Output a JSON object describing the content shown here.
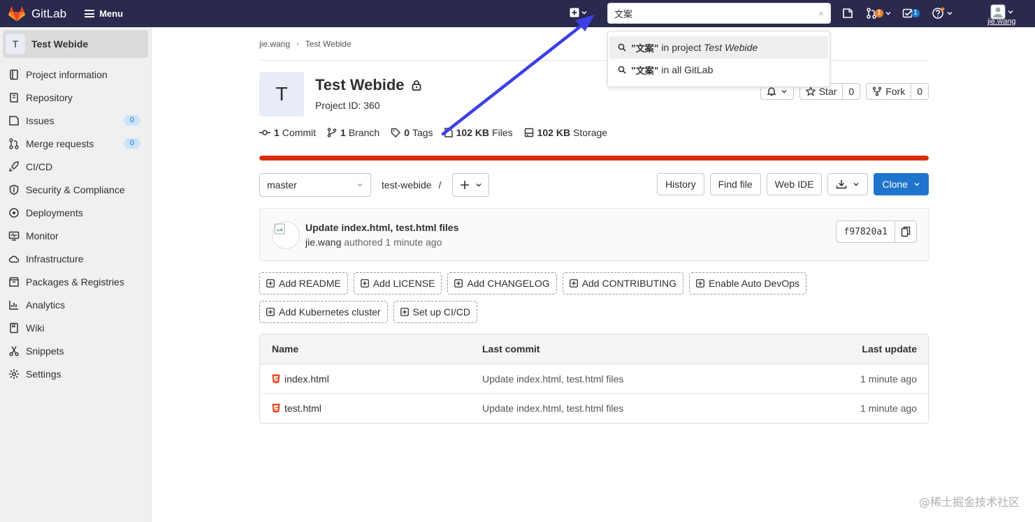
{
  "navbar": {
    "brand": "GitLab",
    "menu_label": "Menu",
    "search_value": "文案",
    "search_clear": "×",
    "merge_requests_count": "1",
    "todos_count": "1",
    "user_name": "jie.wang",
    "colors": {
      "navbar_bg": "#2a2a4f",
      "orange_badge": "#e9822a",
      "blue_badge": "#1f75cb"
    }
  },
  "search_dropdown": {
    "items": [
      {
        "query": "\"文案\"",
        "prefix": " in project ",
        "scope": "Test Webide"
      },
      {
        "query": "\"文案\"",
        "prefix": " in all GitLab",
        "scope": ""
      }
    ]
  },
  "sidebar": {
    "project_initial": "T",
    "project_name": "Test Webide",
    "items": [
      {
        "label": "Project information",
        "icon": "info-icon"
      },
      {
        "label": "Repository",
        "icon": "book-icon"
      },
      {
        "label": "Issues",
        "icon": "issues-icon",
        "count": "0"
      },
      {
        "label": "Merge requests",
        "icon": "merge-request-icon",
        "count": "0"
      },
      {
        "label": "CI/CD",
        "icon": "rocket-icon"
      },
      {
        "label": "Security & Compliance",
        "icon": "shield-icon"
      },
      {
        "label": "Deployments",
        "icon": "deployments-icon"
      },
      {
        "label": "Monitor",
        "icon": "monitor-icon"
      },
      {
        "label": "Infrastructure",
        "icon": "cloud-icon"
      },
      {
        "label": "Packages & Registries",
        "icon": "package-icon"
      },
      {
        "label": "Analytics",
        "icon": "chart-icon"
      },
      {
        "label": "Wiki",
        "icon": "wiki-icon"
      },
      {
        "label": "Snippets",
        "icon": "scissors-icon"
      },
      {
        "label": "Settings",
        "icon": "gear-icon"
      }
    ]
  },
  "breadcrumb": {
    "owner": "jie.wang",
    "project": "Test Webide",
    "separator": "›"
  },
  "project": {
    "initial": "T",
    "name": "Test Webide",
    "id_text": "Project ID: 360",
    "star_label": "Star",
    "star_count": "0",
    "fork_label": "Fork",
    "fork_count": "0",
    "storage_usage_percent": 100,
    "storage_bar_color": "#dd2b0e"
  },
  "stats": {
    "commits_value": "1",
    "commits_label": "Commit",
    "branches_value": "1",
    "branches_label": "Branch",
    "tags_value": "0",
    "tags_label": "Tags",
    "files_value": "102 KB",
    "files_label": "Files",
    "storage_value": "102 KB",
    "storage_label": "Storage"
  },
  "toolbar": {
    "branch": "master",
    "path": "test-webide",
    "path_sep": "/",
    "history": "History",
    "find_file": "Find file",
    "web_ide": "Web IDE",
    "clone": "Clone"
  },
  "last_commit": {
    "title": "Update index.html, test.html files",
    "author": "jie.wang",
    "authored_text": "authored 1 minute ago",
    "sha": "f97820a1"
  },
  "quick_actions": [
    "Add README",
    "Add LICENSE",
    "Add CHANGELOG",
    "Add CONTRIBUTING",
    "Enable Auto DevOps",
    "Add Kubernetes cluster",
    "Set up CI/CD"
  ],
  "file_table": {
    "headers": {
      "name": "Name",
      "last_commit": "Last commit",
      "last_update": "Last update"
    },
    "rows": [
      {
        "name": "index.html",
        "commit": "Update index.html, test.html files",
        "updated": "1 minute ago"
      },
      {
        "name": "test.html",
        "commit": "Update index.html, test.html files",
        "updated": "1 minute ago"
      }
    ]
  },
  "watermark": "@稀土掘金技术社区"
}
